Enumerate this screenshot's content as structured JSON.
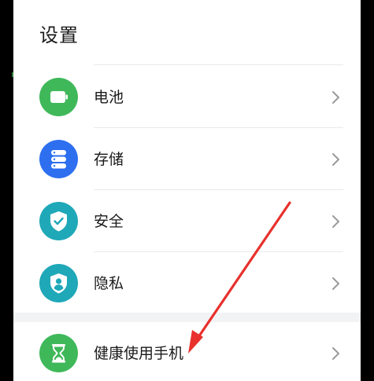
{
  "header": {
    "title": "设置"
  },
  "items": [
    {
      "label": "电池",
      "icon": "battery-icon",
      "color": "#3fb85a"
    },
    {
      "label": "存储",
      "icon": "storage-icon",
      "color": "#2e6ff0"
    },
    {
      "label": "安全",
      "icon": "shield-check-icon",
      "color": "#1fa8b8"
    },
    {
      "label": "隐私",
      "icon": "privacy-icon",
      "color": "#1fa8b8"
    },
    {
      "label": "健康使用手机",
      "icon": "hourglass-icon",
      "color": "#3fb85a"
    }
  ],
  "annotation": {
    "arrow_color": "#e8302c"
  }
}
